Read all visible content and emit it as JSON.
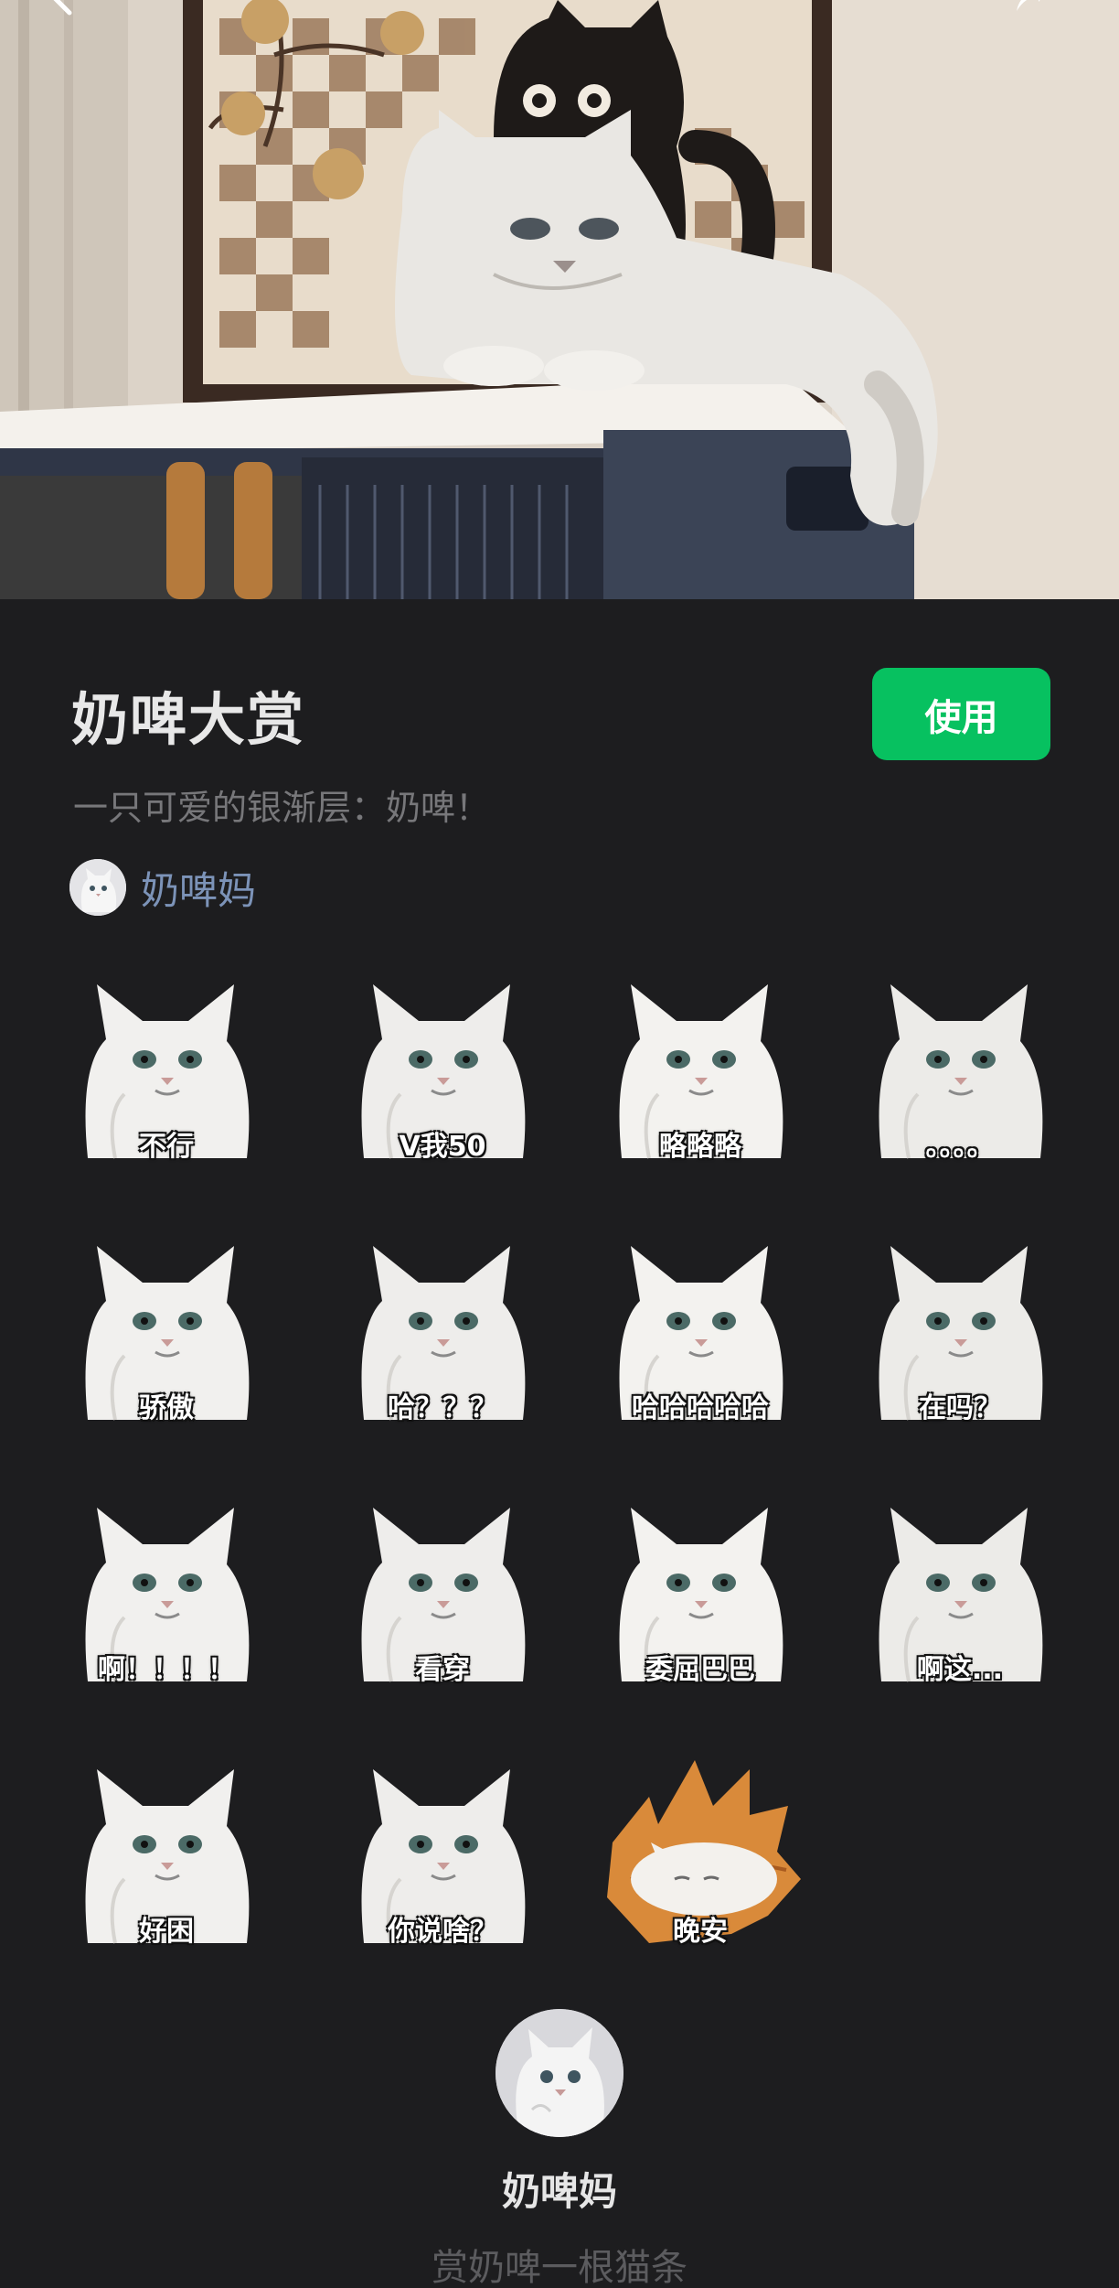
{
  "nav": {
    "back_icon": "chevron-left-icon",
    "share_icon": "share-icon"
  },
  "pack": {
    "title": "奶啤大赏",
    "use_label": "使用",
    "description": "一只可爱的银渐层：奶啤！",
    "author": "奶啤妈"
  },
  "stickers": [
    {
      "caption": "不行"
    },
    {
      "caption": "V我50"
    },
    {
      "caption": "略略略"
    },
    {
      "caption": "。。。。"
    },
    {
      "caption": "骄傲"
    },
    {
      "caption": "哈？？？"
    },
    {
      "caption": "哈哈哈哈哈"
    },
    {
      "caption": "在吗？"
    },
    {
      "caption": "啊！！！！"
    },
    {
      "caption": "看穿"
    },
    {
      "caption": "委屈巴巴"
    },
    {
      "caption": "啊这..."
    },
    {
      "caption": "好困"
    },
    {
      "caption": "你说啥？"
    },
    {
      "caption": "晚安"
    }
  ],
  "footer": {
    "author": "奶啤妈",
    "reward_label": "赏奶啤一根猫条"
  },
  "colors": {
    "accent": "#07c160",
    "background": "#1d1d1f",
    "author_link": "#7c93b8"
  }
}
